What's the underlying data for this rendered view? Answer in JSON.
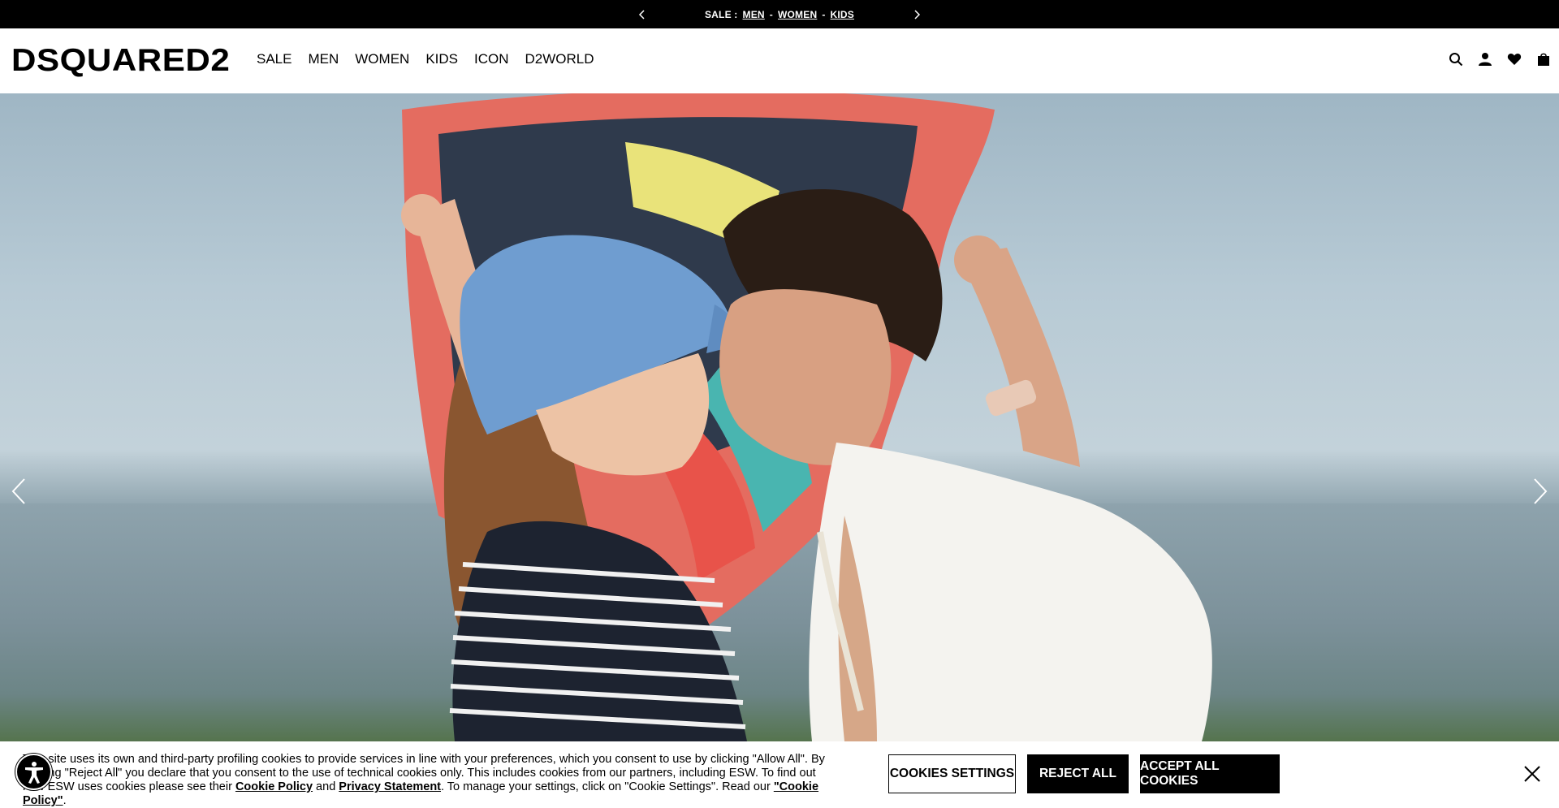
{
  "promo": {
    "label": "SALE :",
    "links": [
      "MEN",
      "WOMEN",
      "KIDS"
    ],
    "sep": "-"
  },
  "header": {
    "logo": "DSQUARED2",
    "nav": [
      "SALE",
      "MEN",
      "WOMEN",
      "KIDS",
      "ICON",
      "D2WORLD"
    ]
  },
  "cookie": {
    "text_part1": "This site uses its own and third-party profiling cookies to provide services in line with your preferences, which you consent to use by clicking \"Allow All\". By clicking \"Reject All\" you declare that you consent to the use of technical cookies only. This includes cookies from our partners, including ESW. To find out how ESW uses cookies please see their ",
    "cookie_policy_link": "Cookie Policy",
    "and": " and ",
    "privacy_link": "Privacy Statement",
    "text_part2": ". To manage your settings, click on \"Cookie Settings\". Read our ",
    "cookie_policy_quoted": "\"Cookie Policy\"",
    "text_end": ".",
    "settings_label": "COOKIES SETTINGS",
    "reject_label": "REJECT ALL",
    "accept_label": "ACCEPT ALL COOKIES"
  },
  "colors": {
    "black": "#000000",
    "white": "#ffffff"
  }
}
